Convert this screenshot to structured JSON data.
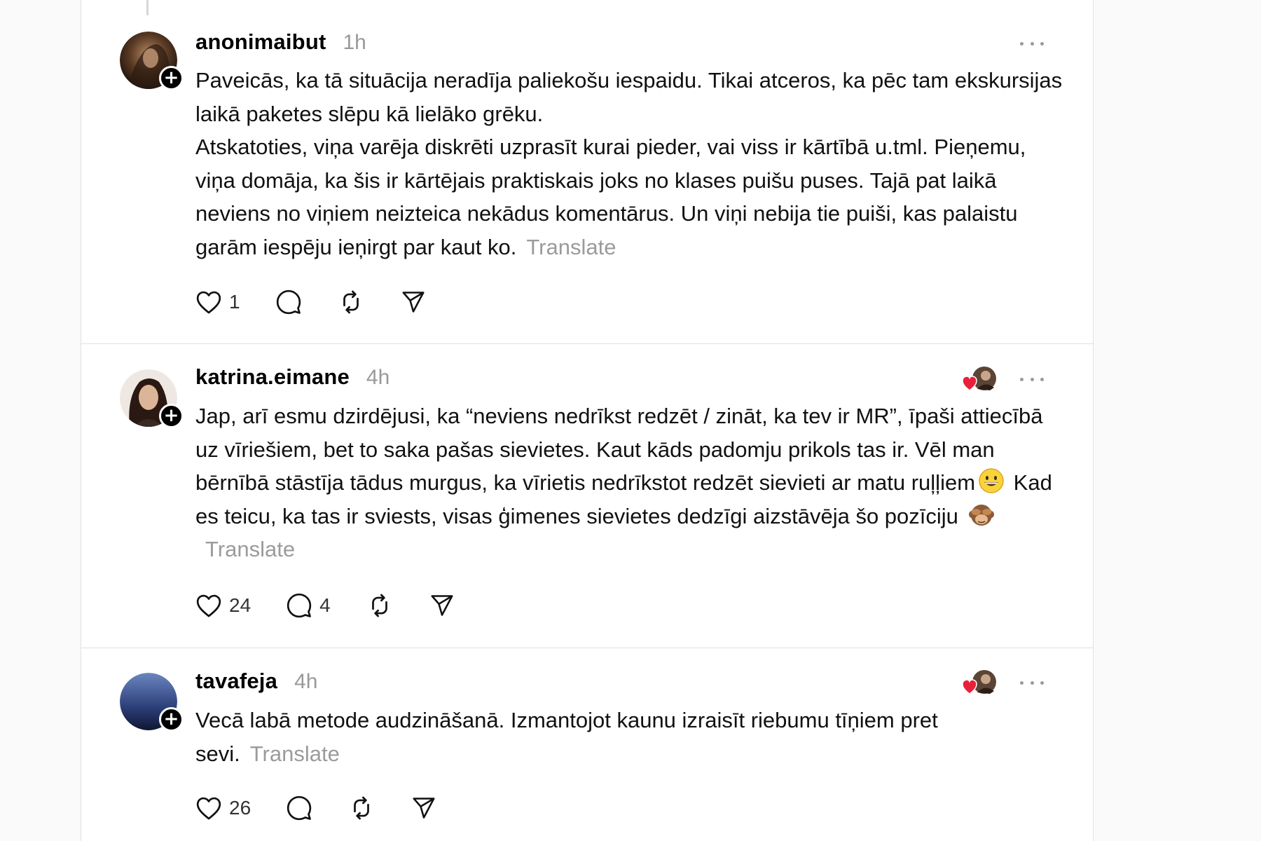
{
  "posts": [
    {
      "username": "anonimaibut",
      "time": "1h",
      "paragraphs": [
        "Paveicās, ka tā situācija neradīja paliekošu iespaidu. Tikai atceros, ka pēc tam ekskursijas laikā paketes slēpu kā lielāko grēku."
      ],
      "last_paragraph": "Atskatoties, viņa varēja diskrēti uzprasīt kurai pieder, vai viss ir kārtībā u.tml. Pieņemu, viņa domāja, ka šis ir kārtējais praktiskais joks no klases puišu puses. Tajā pat laikā neviens no viņiem neizteica nekādus komentārus. Un viņi nebija tie puiši, kas palaistu garām iespēju ieņirgt par kaut ko.",
      "translate": "Translate",
      "like_count": "1",
      "reply_count": "",
      "liked_by_shown": false
    },
    {
      "username": "katrina.eimane",
      "time": "4h",
      "text_part1": "Jap, arī esmu dzirdējusi, ka “neviens nedrīkst redzēt / zināt, ka tev ir MR”, īpaši attiecībā uz vīriešiem, bet to saka pašas sievietes. Kaut kāds padomju prikols tas ir. Vēl man bērnībā stāstīja tādus murgus, ka vīrietis nedrīkstot redzēt sievieti ar matu ruļļiem",
      "text_part2": "Kad es teicu, ka tas ir sviests, visas ģimenes sievietes dedzīgi aizstāvēja šo pozīciju",
      "emoji_1": "grinning-face-emoji",
      "emoji_2": "see-no-evil-monkey-emoji",
      "translate": "Translate",
      "like_count": "24",
      "reply_count": "4",
      "liked_by_shown": true
    },
    {
      "username": "tavafeja",
      "time": "4h",
      "text": "Vecā labā metode audzināšanā. Izmantojot kaunu izraisīt riebumu tīņiem pret sevi.",
      "translate": "Translate",
      "like_count": "26",
      "reply_count": "",
      "liked_by_shown": true
    }
  ],
  "icons": {
    "like": "heart-icon",
    "reply": "comment-bubble-icon",
    "repost": "repost-icon",
    "share": "send-paper-plane-icon",
    "more": "more-dots-icon",
    "follow": "plus-icon"
  },
  "colors": {
    "text": "#111111",
    "muted": "#999999",
    "like_heart_red": "#e8203a",
    "divider": "#e0e0e0"
  }
}
